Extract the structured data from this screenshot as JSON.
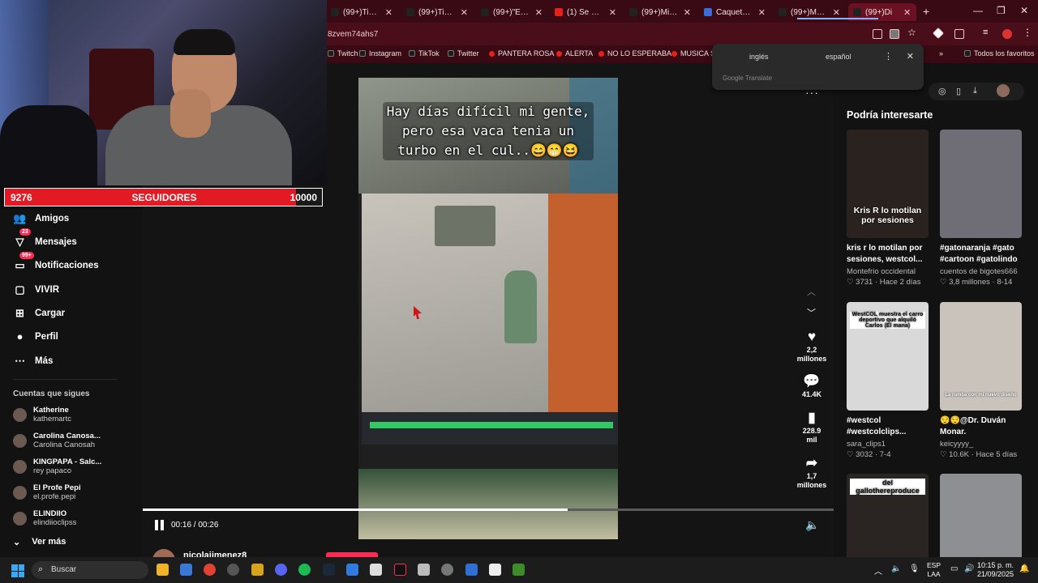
{
  "browser": {
    "tabs": [
      {
        "title": "(99+)TikTok",
        "icon": "tiktok"
      },
      {
        "title": "(99+)TikTok",
        "icon": "tiktok"
      },
      {
        "title": "(99+)\"El mi",
        "icon": "tiktok"
      },
      {
        "title": "(1) Se hizo p",
        "icon": "youtube"
      },
      {
        "title": "(99+)Mi cam",
        "icon": "tiktok"
      },
      {
        "title": "Caqueta del",
        "icon": "other"
      },
      {
        "title": "(99+)Madan",
        "icon": "tiktok"
      },
      {
        "title": "(99+)Di",
        "icon": "tiktok",
        "active": true
      }
    ],
    "url": "8zvem74ahs7",
    "bookmarks": [
      "Twitch",
      "Instagram",
      "TikTok",
      "Twitter",
      "PANTERA ROSA",
      "ALERTA",
      "NO LO ESPERABA",
      "MUSICA SA"
    ],
    "all_bookmarks": "Todos los favoritos"
  },
  "translate_popup": {
    "tab_source": "inglés",
    "tab_target": "español",
    "brand": "Google Translate"
  },
  "stream_overlay": {
    "followers_current": "9276",
    "followers_label": "SEGUIDORES",
    "followers_goal": "10000"
  },
  "nav": {
    "items": [
      {
        "label": "Amigos",
        "icon": "friends-icon"
      },
      {
        "label": "Mensajes",
        "icon": "messages-icon",
        "badge": "23"
      },
      {
        "label": "Notificaciones",
        "icon": "notifications-icon",
        "badge": "99+"
      },
      {
        "label": "VIVIR",
        "icon": "live-icon"
      },
      {
        "label": "Cargar",
        "icon": "upload-icon"
      },
      {
        "label": "Perfil",
        "icon": "profile-icon"
      },
      {
        "label": "Más",
        "icon": "more-icon"
      }
    ],
    "following_title": "Cuentas que sigues",
    "following": [
      {
        "name": "Katherine",
        "handle": "kathemartc"
      },
      {
        "name": "Carolina Canosa...",
        "handle": "Carolina Canosah"
      },
      {
        "name": "KINGPAPA - Salc...",
        "handle": "rey papaco"
      },
      {
        "name": "El Profe Pepi",
        "handle": "el.profe.pepi"
      },
      {
        "name": "ELINDIIO",
        "handle": "elindiioclipss"
      }
    ],
    "see_more": "Ver más"
  },
  "video": {
    "caption": "Hay días difícil mi gente, pero esa vaca tenia un turbo en el cul..😄😁😆",
    "time": "00:16 / 00:26",
    "progress": 0.615,
    "creator": "nicolajimenez8",
    "likes": "2,2 millones",
    "comments": "41.4K",
    "saves": "228.9 mil",
    "shares": "1,7 millones"
  },
  "suggestions": {
    "title": "Podría interesarte",
    "cards": [
      {
        "overlay": "Kris R lo motilan por sesiones",
        "title": "kris r lo motilan por sesiones, westcol...",
        "author": "Montefrio occidental",
        "likes": "3731",
        "when": "Hace 2 días",
        "color": "#2a221e"
      },
      {
        "overlay": "",
        "title": "#gatonaranja #gato #cartoon #gatolindo",
        "author": "cuentos de bigotes666",
        "likes": "3,8 millones",
        "when": "8-14",
        "color": "#6f6e77"
      },
      {
        "overlay": "WestCOL muestra el carro deportivo que alquiló Carlos (El mana)",
        "title": "#westcol #westcolclips...",
        "author": "sara_clips1",
        "likes": "3032",
        "when": "7-4",
        "color": "#d9d9d9"
      },
      {
        "overlay": "La rumba con mi nuevo diseño",
        "title": "😌😌@Dr. Duván Monar.",
        "author": "keicyyyy_",
        "likes": "10.6K",
        "when": "Hace 5 días",
        "color": "#c9c3bc"
      },
      {
        "overlay": "del gallothereproduce",
        "title": "",
        "author": "",
        "likes": "",
        "when": "",
        "color": "#2a2523"
      },
      {
        "overlay": "",
        "title": "",
        "author": "",
        "likes": "",
        "when": "",
        "color": "#8d8f92"
      }
    ]
  },
  "taskbar": {
    "search_placeholder": "Buscar",
    "lang_top": "ESP",
    "lang_bottom": "LAA",
    "time": "10:15 p. m.",
    "date": "21/09/2025"
  }
}
